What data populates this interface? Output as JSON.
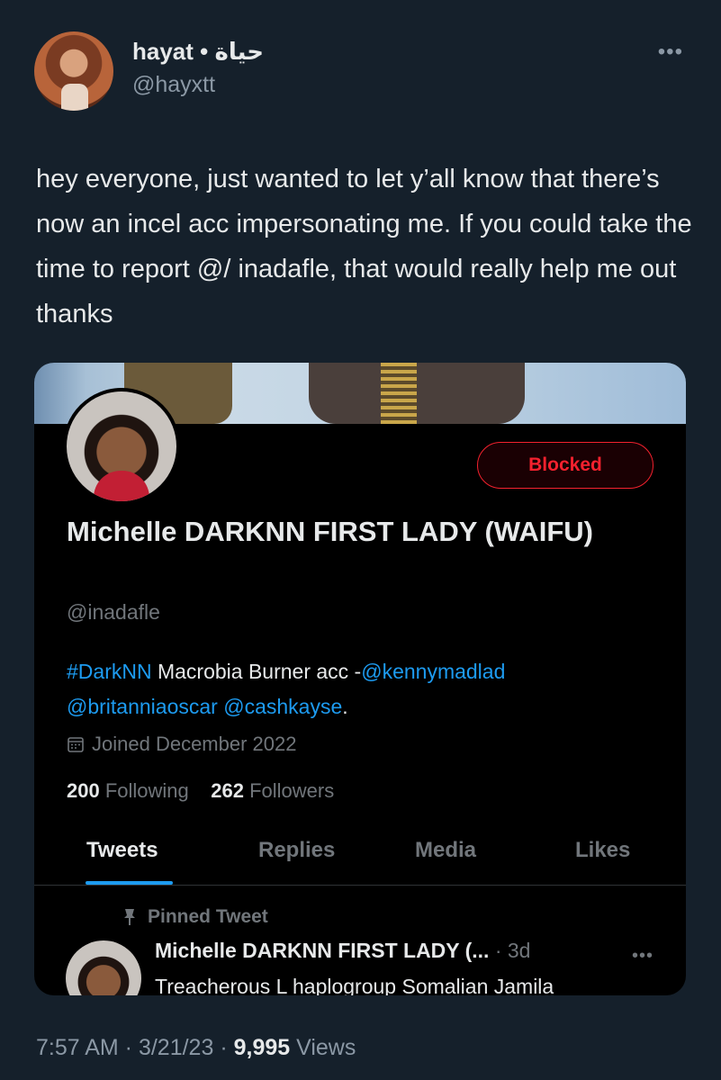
{
  "author": {
    "name": "hayat • حياة",
    "handle": "@hayxtt"
  },
  "more_label": "•••",
  "tweet_text": "hey everyone, just wanted to let y’all know that there’s now an incel acc impersonating me. If you could take the time to report @/ inadafle, that would really help me out thanks",
  "card": {
    "blocked_label": "Blocked",
    "display_name": "Michelle DARKNN FIRST LADY (WAIFU)",
    "handle": "@inadafle",
    "bio": {
      "hashtag": "#DarkNN",
      "text1": " Macrobia Burner acc -",
      "mention1": "@kennymadlad",
      "mention2": "@britanniaoscar",
      "mention3": "@cashkayse",
      "end": "."
    },
    "joined": "Joined December 2022",
    "following_count": "200",
    "following_label": "Following",
    "followers_count": "262",
    "followers_label": "Followers",
    "tabs": [
      "Tweets",
      "Replies",
      "Media",
      "Likes"
    ],
    "pinned_label": "Pinned Tweet",
    "pinned_author": "Michelle DARKNN FIRST LADY (...",
    "pinned_time": "· 3d",
    "pinned_preview": "Treacherous L haplogroup Somalian Jamila"
  },
  "meta": {
    "time": "7:57 AM",
    "date": "3/21/23",
    "views_count": "9,995",
    "views_label": "Views"
  }
}
